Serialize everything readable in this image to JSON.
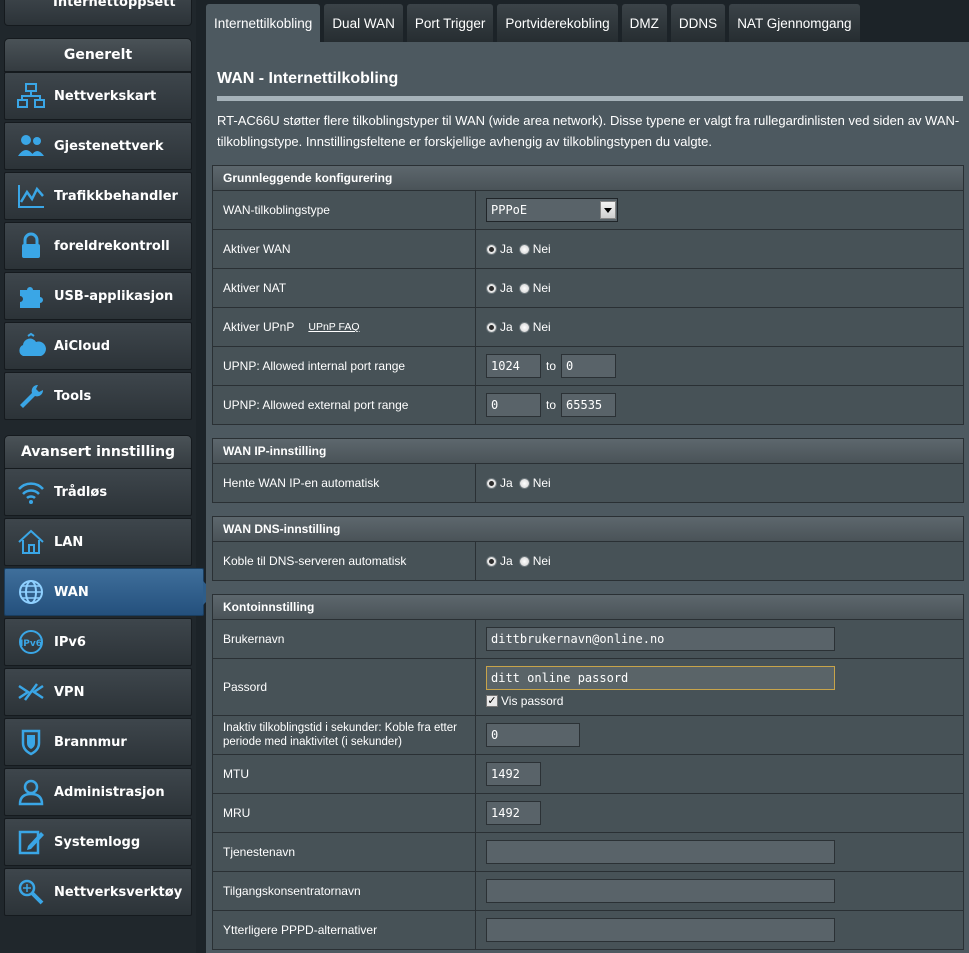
{
  "sidebar": {
    "top_item": "Internettoppsett",
    "general_header": "Generelt",
    "general_items": [
      {
        "label": "Nettverkskart",
        "icon": "network-map-icon"
      },
      {
        "label": "Gjestenettverk",
        "icon": "guest-network-icon"
      },
      {
        "label": "Trafikkbehandler",
        "icon": "traffic-manager-icon"
      },
      {
        "label": "foreldrekontroll",
        "icon": "lock-icon"
      },
      {
        "label": "USB-applikasjon",
        "icon": "puzzle-icon"
      },
      {
        "label": "AiCloud",
        "icon": "cloud-icon"
      },
      {
        "label": "Tools",
        "icon": "wrench-icon"
      }
    ],
    "advanced_header": "Avansert innstilling",
    "advanced_items": [
      {
        "label": "Trådløs",
        "icon": "wifi-icon"
      },
      {
        "label": "LAN",
        "icon": "home-icon"
      },
      {
        "label": "WAN",
        "icon": "globe-icon",
        "active": true
      },
      {
        "label": "IPv6",
        "icon": "ipv6-icon"
      },
      {
        "label": "VPN",
        "icon": "vpn-icon"
      },
      {
        "label": "Brannmur",
        "icon": "shield-icon"
      },
      {
        "label": "Administrasjon",
        "icon": "admin-user-icon"
      },
      {
        "label": "Systemlogg",
        "icon": "log-edit-icon"
      },
      {
        "label": "Nettverksverktøy",
        "icon": "network-tools-icon"
      }
    ]
  },
  "tabs": [
    "Internettilkobling",
    "Dual WAN",
    "Port Trigger",
    "Portviderekobling",
    "DMZ",
    "DDNS",
    "NAT Gjennomgang"
  ],
  "active_tab": 0,
  "page": {
    "title": "WAN - Internettilkobling",
    "description": "RT-AC66U støtter flere tilkoblingstyper til WAN (wide area network). Disse typene er valgt fra rullegardinlisten ved siden av WAN-tilkoblingstype. Innstillingsfeltene er forskjellige avhengig av tilkoblingstypen du valgte."
  },
  "radio": {
    "yes": "Ja",
    "no": "Nei"
  },
  "range_to": "to",
  "basic": {
    "header": "Grunnleggende konfigurering",
    "wan_type_label": "WAN-tilkoblingstype",
    "wan_type_value": "PPPoE",
    "enable_wan_label": "Aktiver WAN",
    "enable_nat_label": "Aktiver NAT",
    "enable_upnp_label": "Aktiver UPnP",
    "upnp_faq": "UPnP  FAQ",
    "upnp_internal_label": "UPNP: Allowed internal port range",
    "upnp_internal_from": "1024",
    "upnp_internal_to": "0",
    "upnp_external_label": "UPNP: Allowed external port range",
    "upnp_external_from": "0",
    "upnp_external_to": "65535"
  },
  "wan_ip": {
    "header": "WAN IP-innstilling",
    "auto_label": "Hente WAN IP-en automatisk"
  },
  "wan_dns": {
    "header": "WAN DNS-innstilling",
    "auto_label": "Koble til DNS-serveren automatisk"
  },
  "account": {
    "header": "Kontoinnstilling",
    "username_label": "Brukernavn",
    "username_value": "dittbrukernavn@online.no",
    "password_label": "Passord",
    "password_value": "ditt online passord",
    "show_password_label": "Vis passord",
    "idle_label": "Inaktiv tilkoblingstid i sekunder: Koble fra etter periode med inaktivitet (i sekunder)",
    "idle_value": "0",
    "mtu_label": "MTU",
    "mtu_value": "1492",
    "mru_label": "MRU",
    "mru_value": "1492",
    "service_label": "Tjenestenavn",
    "service_value": "",
    "ac_label": "Tilgangskonsentratornavn",
    "ac_value": "",
    "pppd_label": "Ytterligere PPPD-alternativer",
    "pppd_value": ""
  }
}
